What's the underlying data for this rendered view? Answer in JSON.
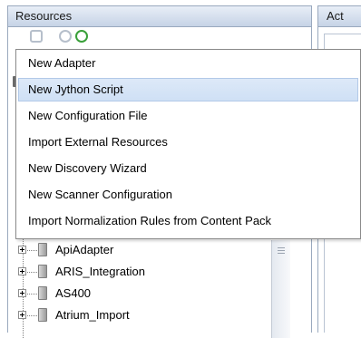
{
  "left_panel": {
    "title": "Resources"
  },
  "right_panel": {
    "title": "Act"
  },
  "toolbar": {
    "icons": [
      "resource-tool-icon",
      "search-icon",
      "refresh-icon"
    ]
  },
  "context_menu": {
    "items": [
      {
        "label": "New Adapter"
      },
      {
        "label": "New Jython Script",
        "highlighted": true
      },
      {
        "label": "New Configuration File"
      },
      {
        "label": "Import External Resources"
      },
      {
        "label": "New Discovery Wizard"
      },
      {
        "label": "New Scanner Configuration"
      },
      {
        "label": "Import Normalization Rules from Content Pack"
      }
    ]
  },
  "tree": {
    "items": [
      {
        "label": "ApiAdapter"
      },
      {
        "label": "ARIS_Integration"
      },
      {
        "label": "AS400"
      },
      {
        "label": "Atrium_Import"
      }
    ]
  }
}
